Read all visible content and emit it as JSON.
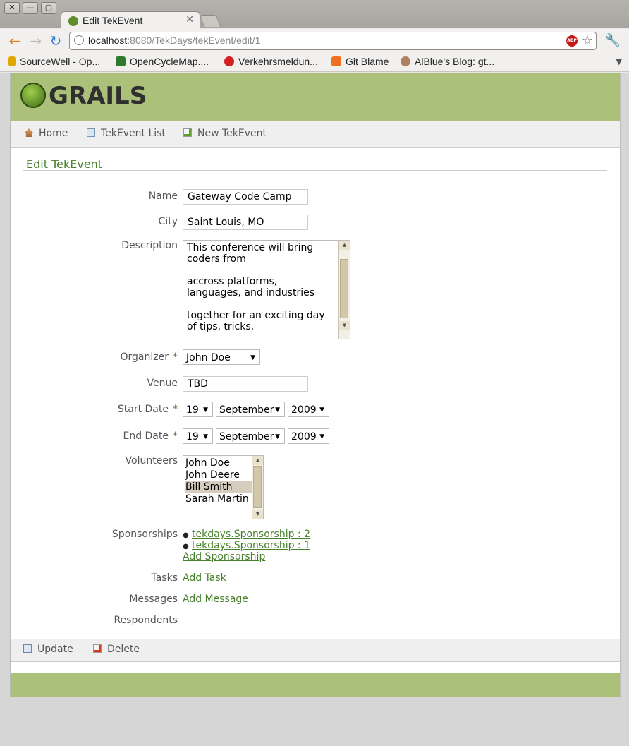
{
  "browser": {
    "window_controls": [
      "✕",
      "—",
      "▢"
    ],
    "tab_title": "Edit TekEvent",
    "url_host": "localhost",
    "url_rest": ":8080/TekDays/tekEvent/edit/1",
    "abp_label": "ABP",
    "bookmarks": [
      {
        "label": "SourceWell - Op...",
        "color": "#e0a800"
      },
      {
        "label": "OpenCycleMap....",
        "color": "#2d7a2d"
      },
      {
        "label": "Verkehrsmeldun...",
        "color": "#d32020"
      },
      {
        "label": "Git Blame",
        "color": "#f07020"
      },
      {
        "label": "AlBlue's Blog: gt...",
        "color": "#b08060"
      }
    ]
  },
  "app": {
    "logo_text": "GRAILS",
    "accent_color": "#48802c",
    "header_color": "#abc17a"
  },
  "nav": {
    "home": "Home",
    "list": "TekEvent List",
    "create": "New TekEvent"
  },
  "page": {
    "heading": "Edit TekEvent"
  },
  "form": {
    "name": {
      "label": "Name",
      "value": "Gateway Code Camp"
    },
    "city": {
      "label": "City",
      "value": "Saint Louis, MO"
    },
    "description": {
      "label": "Description",
      "value": "This conference will bring coders from\n\naccross platforms, languages, and industries\n\ntogether for an exciting day of tips, tricks,"
    },
    "organizer": {
      "label": "Organizer",
      "value": "John Doe"
    },
    "venue": {
      "label": "Venue",
      "value": "TBD"
    },
    "start_date": {
      "label": "Start Date",
      "day": "19",
      "month": "September",
      "year": "2009"
    },
    "end_date": {
      "label": "End Date",
      "day": "19",
      "month": "September",
      "year": "2009"
    },
    "volunteers": {
      "label": "Volunteers",
      "options": [
        "John Doe",
        "John Deere",
        "Bill Smith",
        "Sarah Martin"
      ],
      "selected": "Bill Smith"
    },
    "sponsorships": {
      "label": "Sponsorships",
      "items": [
        "tekdays.Sponsorship : 2",
        "tekdays.Sponsorship : 1"
      ],
      "add": "Add Sponsorship"
    },
    "tasks": {
      "label": "Tasks",
      "add": "Add Task"
    },
    "messages": {
      "label": "Messages",
      "add": "Add Message"
    },
    "respondents": {
      "label": "Respondents"
    },
    "required_mark": "*"
  },
  "buttons": {
    "update": "Update",
    "delete": "Delete"
  }
}
